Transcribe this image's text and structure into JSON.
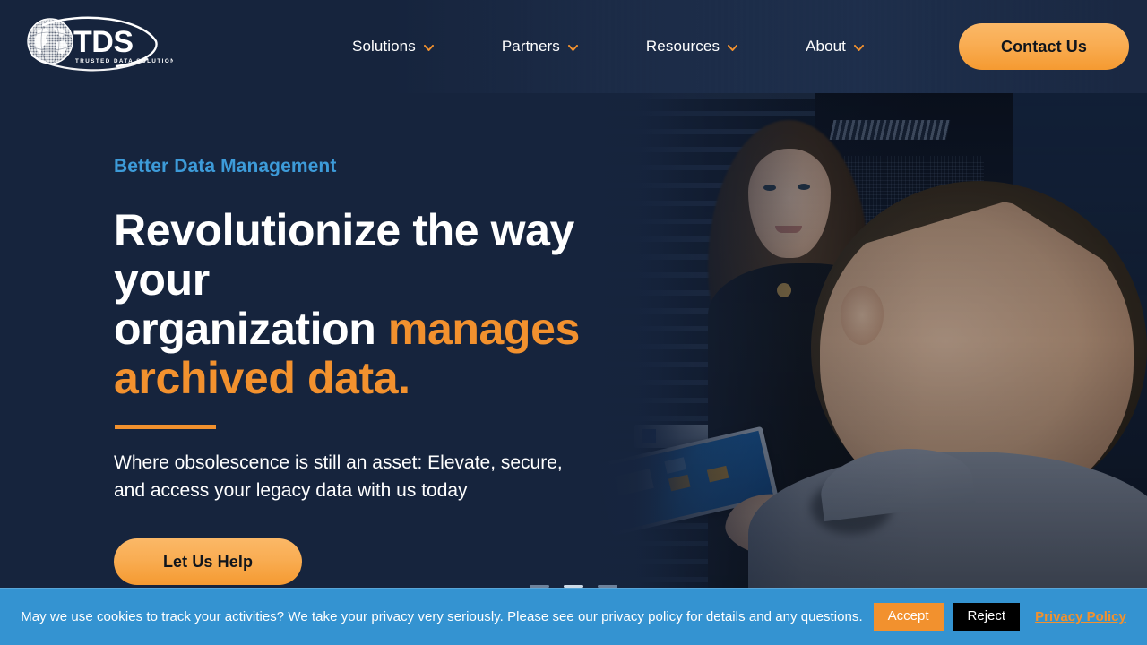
{
  "site": {
    "logo": {
      "wordmark": "TDS",
      "tagline": "TRUSTED DATA SOLUTIONS",
      "icon": "globe-icon"
    }
  },
  "header": {
    "nav": [
      {
        "label": "Solutions",
        "icon": "chevron-down-icon"
      },
      {
        "label": "Partners",
        "icon": "chevron-down-icon"
      },
      {
        "label": "Resources",
        "icon": "chevron-down-icon"
      },
      {
        "label": "About",
        "icon": "chevron-down-icon"
      }
    ],
    "contact_label": "Contact Us"
  },
  "hero": {
    "eyebrow": "Better Data Management",
    "headline_line1": "Revolutionize the way your",
    "headline_line2_plain": "organization ",
    "headline_line2_accent": "manages",
    "headline_line3_accent": "archived data.",
    "subcopy_line1": "Where obsolescence is still an asset: Elevate, secure,",
    "subcopy_line2": "and access your legacy data with us today",
    "cta_label": "Let Us Help",
    "slides": [
      "slide-1",
      "slide-2",
      "slide-3"
    ]
  },
  "cookie_banner": {
    "message": "May we use cookies to track your activities? We take your privacy very seriously. Please see our privacy policy for details and any questions.",
    "accept_label": "Accept",
    "reject_label": "Reject",
    "privacy_link_label": "Privacy Policy"
  },
  "colors": {
    "navy": "#16243d",
    "orange": "#f2912e",
    "orange_light": "#fbb867",
    "blue_accent": "#3d9bd9",
    "cookie_blue": "#3493d1",
    "white": "#ffffff",
    "black": "#000000"
  }
}
